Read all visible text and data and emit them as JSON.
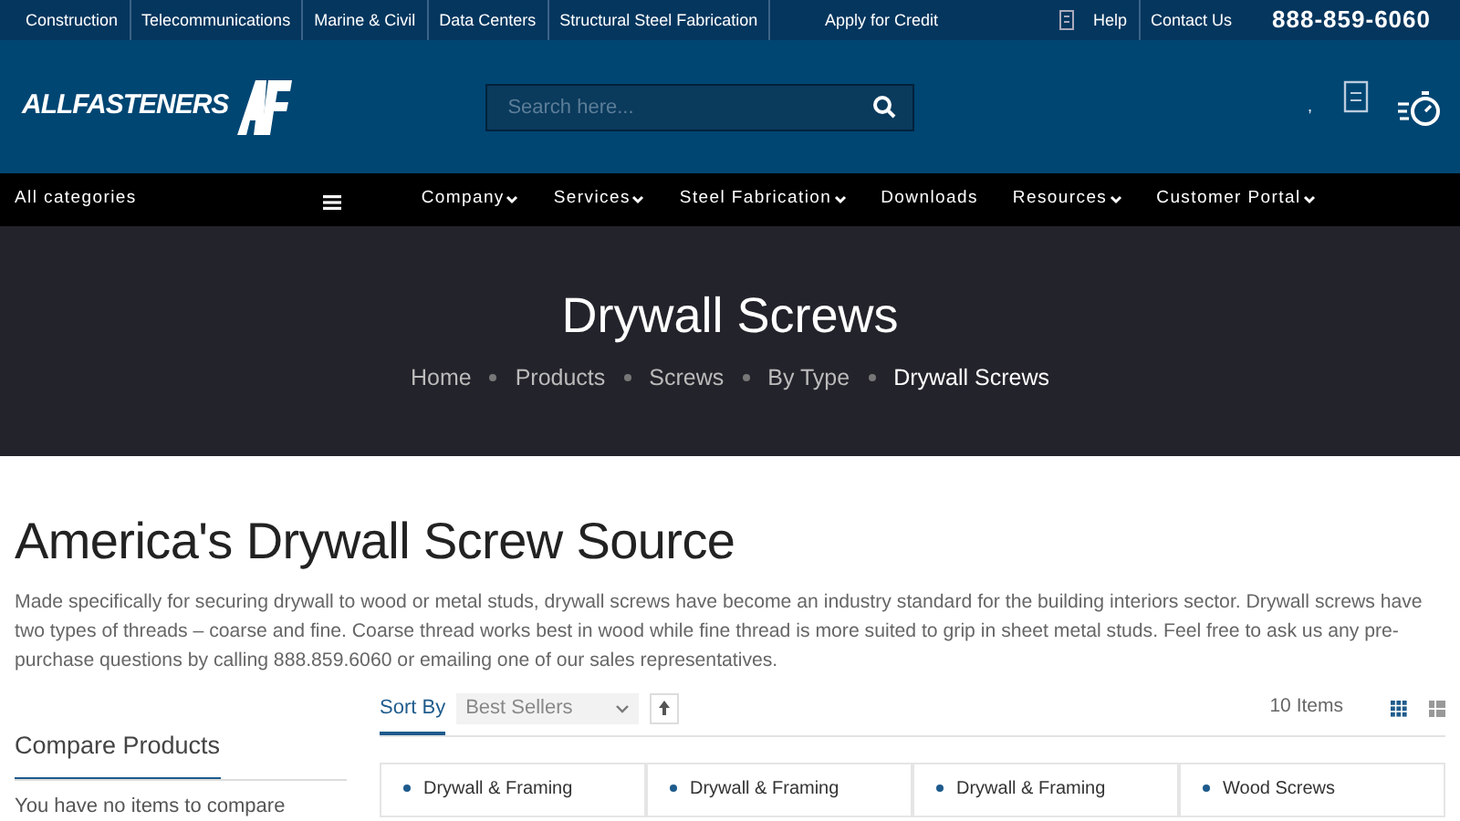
{
  "top_bar": {
    "links": [
      "Construction",
      "Telecommunications",
      "Marine & Civil",
      "Data Centers",
      "Structural Steel Fabrication"
    ],
    "credit": "Apply for Credit",
    "right_links": [
      "Help",
      "Contact Us"
    ],
    "phone": "888-859-6060"
  },
  "header": {
    "logo": "ALLFASTENERS",
    "search": {
      "placeholder": "Search here..."
    },
    "mark": ","
  },
  "nav": {
    "categories": "All categories",
    "items": [
      {
        "label": "Company",
        "dropdown": true
      },
      {
        "label": "Services",
        "dropdown": true
      },
      {
        "label": "Steel Fabrication",
        "dropdown": true
      },
      {
        "label": "Downloads",
        "dropdown": false
      },
      {
        "label": "Resources",
        "dropdown": true
      },
      {
        "label": "Customer Portal",
        "dropdown": true
      }
    ]
  },
  "hero": {
    "title": "Drywall Screws",
    "breadcrumbs": [
      {
        "label": "Home",
        "current": false
      },
      {
        "label": "Products",
        "current": false
      },
      {
        "label": "Screws",
        "current": false
      },
      {
        "label": "By Type",
        "current": false
      },
      {
        "label": "Drywall Screws",
        "current": true
      }
    ]
  },
  "heading": "America's Drywall Screw Source",
  "intro": "Made specifically for securing drywall to wood or metal studs, drywall screws have become an industry standard for the building interiors sector. Drywall screws have two types of threads – coarse and fine. Coarse thread works best in wood while fine thread is more suited to grip in sheet metal studs. Feel free to ask us any pre-purchase questions by calling 888.859.6060 or emailing one of our sales representatives.",
  "sidebar": {
    "title": "Compare Products",
    "text": "You have no items to compare"
  },
  "toolbar": {
    "sort_label": "Sort By",
    "sort_value": "Best Sellers",
    "count": "10 Items",
    "views": [
      {
        "kind": "grid",
        "selected": true
      },
      {
        "kind": "list",
        "selected": false
      }
    ]
  },
  "products": [
    "Drywall & Framing",
    "Drywall & Framing",
    "Drywall & Framing",
    "Wood Screws"
  ]
}
